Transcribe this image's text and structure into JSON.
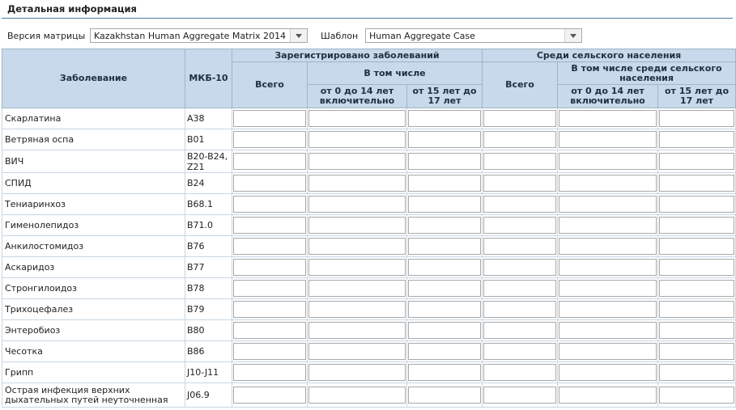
{
  "section": {
    "title": "Детальная информация"
  },
  "filters": {
    "matrix_label": "Версия матрицы",
    "matrix_value": "Kazakhstan Human Aggregate Matrix 2014",
    "template_label": "Шаблон",
    "template_value": "Human Aggregate Case"
  },
  "table": {
    "headers": {
      "disease": "Заболевание",
      "icd": "МКБ-10",
      "registered": "Зарегистрировано заболеваний",
      "rural": "Среди сельского населения",
      "total": "Всего",
      "including": "В том числе",
      "including_rural": "В том числе среди сельского населения",
      "age_0_14": "от 0 до 14 лет включительно",
      "age_15_17": "от 15 лет до 17 лет"
    },
    "rows": [
      {
        "disease": "Скарлатина",
        "code": "A38"
      },
      {
        "disease": "Ветряная оспа",
        "code": "B01"
      },
      {
        "disease": "ВИЧ",
        "code": "B20-B24, Z21"
      },
      {
        "disease": "СПИД",
        "code": "B24"
      },
      {
        "disease": "Тениаринхоз",
        "code": "B68.1"
      },
      {
        "disease": "Гименолепидоз",
        "code": "B71.0"
      },
      {
        "disease": "Анкилостомидоз",
        "code": "B76"
      },
      {
        "disease": "Аскаридоз",
        "code": "B77"
      },
      {
        "disease": "Стронгилоидоз",
        "code": "B78"
      },
      {
        "disease": "Трихоцефалез",
        "code": "B79"
      },
      {
        "disease": "Энтеробиоз",
        "code": "B80"
      },
      {
        "disease": "Чесотка",
        "code": "B86"
      },
      {
        "disease": "Грипп",
        "code": "J10-J11"
      },
      {
        "disease": "Острая инфекция верхних дыхательных путей неуточненная",
        "code": "J06.9"
      }
    ]
  }
}
